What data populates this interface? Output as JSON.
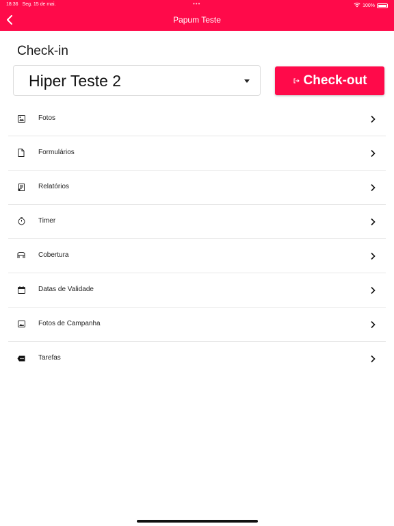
{
  "status_bar": {
    "time": "18:36",
    "date": "Seg. 15 de mai.",
    "battery": "100%"
  },
  "header": {
    "title": "Papum Teste"
  },
  "checkin": {
    "label": "Check-in",
    "store_value": "Hiper Teste 2",
    "checkout_label": "Check-out"
  },
  "menu": {
    "items": [
      {
        "label": "Fotos",
        "icon": "image-icon"
      },
      {
        "label": "Formulários",
        "icon": "document-icon"
      },
      {
        "label": "Relatórios",
        "icon": "report-icon"
      },
      {
        "label": "Timer",
        "icon": "timer-icon"
      },
      {
        "label": "Cobertura",
        "icon": "shelf-icon"
      },
      {
        "label": "Datas de Validade",
        "icon": "calendar-icon"
      },
      {
        "label": "Fotos de Campanha",
        "icon": "campaign-photo-icon"
      },
      {
        "label": "Tarefas",
        "icon": "label-tag-icon"
      }
    ]
  },
  "colors": {
    "accent": "#ff0a4a"
  }
}
